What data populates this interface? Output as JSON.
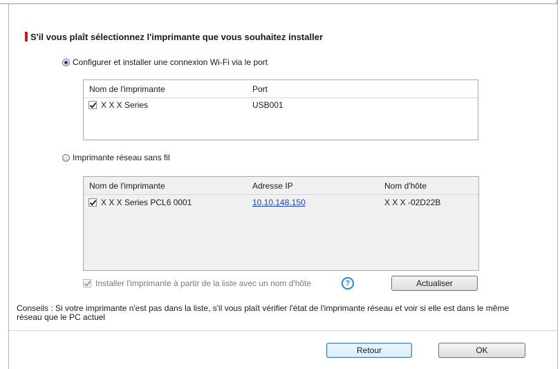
{
  "heading": "S'il vous plaît sélectionnez l'imprimante que vous souhaitez installer",
  "options": {
    "wifi_config_label": "Configurer et installer une connexion Wi-Fi via le port",
    "wireless_label": "Imprimante réseau sans fil"
  },
  "usb_table": {
    "col_name": "Nom de l'imprimante",
    "col_port": "Port",
    "rows": [
      {
        "name": "X X X Series",
        "port": "USB001",
        "checked": true
      }
    ]
  },
  "network_table": {
    "col_name": "Nom de l'imprimante",
    "col_ip": "Adresse IP",
    "col_host": "Nom d'hôte",
    "rows": [
      {
        "name": "X X X Series PCL6 0001",
        "ip": "10.10.148.150",
        "host": "X X X -02D22B",
        "checked": true
      }
    ]
  },
  "install_hostname_label": "Installer l'imprimante à partir de la liste avec un nom d'hôte",
  "help_icon_glyph": "?",
  "refresh_label": "Actualiser",
  "tips_text": "Conseils : Si votre imprimante n'est pas dans la liste, s'il vous plaît vérifier l'état de l'imprimante réseau et voir si elle est dans le même réseau que le PC actuel",
  "back_label": "Retour",
  "ok_label": "OK",
  "colors": {
    "accent_bar": "#d21a1a",
    "link": "#1a3fc0",
    "help_icon": "#2a86d0"
  }
}
